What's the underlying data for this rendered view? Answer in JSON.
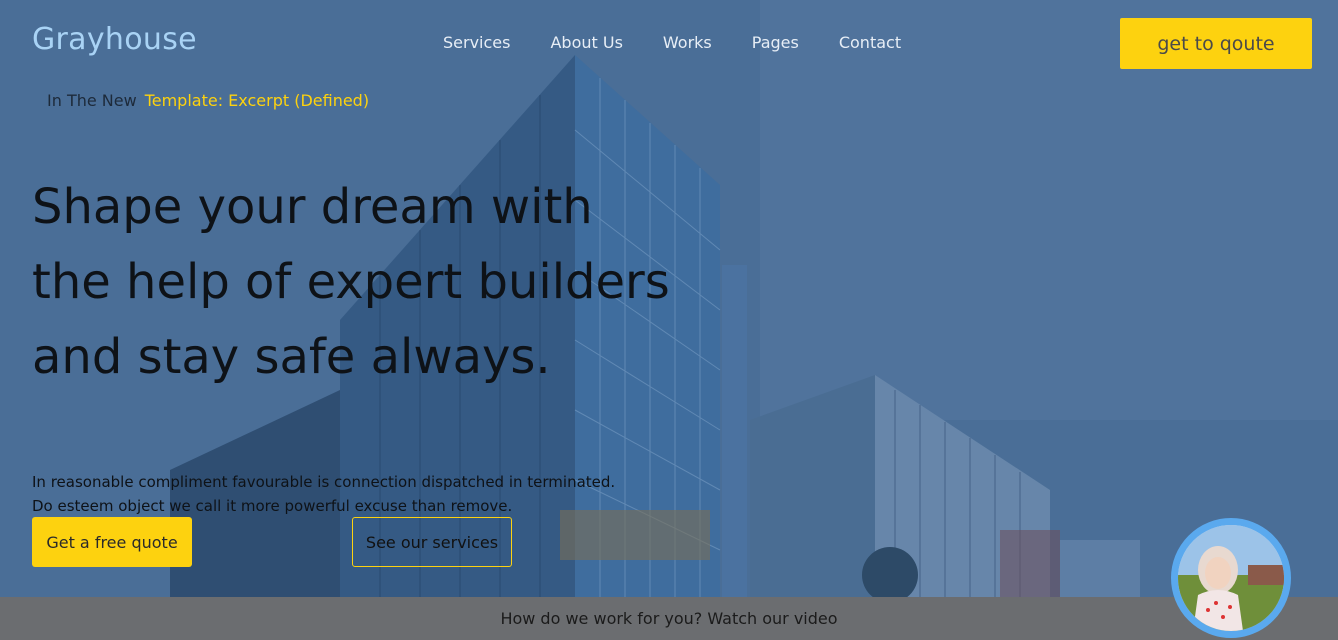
{
  "brand": {
    "name": "Grayhouse"
  },
  "nav": {
    "items": [
      "Services",
      "About Us",
      "Works",
      "Pages",
      "Contact"
    ],
    "cta": "get to qoute"
  },
  "ticker": {
    "lead": "In The New",
    "highlight": "Template: Excerpt (Defined)"
  },
  "hero": {
    "headline": "Shape your dream with the help of expert builders and stay safe always.",
    "subtext_line1": "In reasonable compliment favourable is connection dispatched in terminated.",
    "subtext_line2": "Do esteem object we call it more powerful excuse than remove.",
    "primary_button": "Get a free quote",
    "secondary_button": "See our services"
  },
  "video_bar": {
    "text": "How do we work for you? Watch our video"
  },
  "colors": {
    "accent": "#fdd20f",
    "logo": "#a9d3f5",
    "avatar_ring": "#5aa9ee"
  },
  "icons": {
    "avatar": "user-avatar-photo"
  }
}
